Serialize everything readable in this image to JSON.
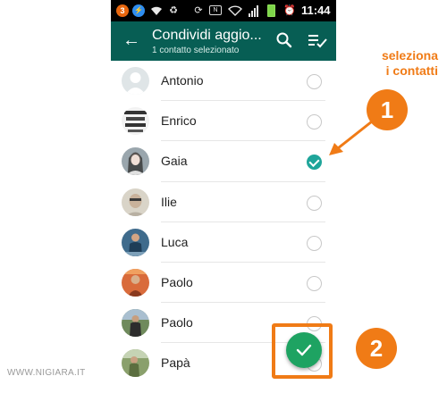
{
  "status_bar": {
    "notification_badge": "3",
    "time": "11:44",
    "icons": [
      "notification-badge-icon",
      "messenger-icon",
      "wifi-icon",
      "recycle-icon",
      "sync-icon",
      "nfc-icon",
      "wifi-signal-icon",
      "cell-signal-icon",
      "battery-icon",
      "alarm-icon"
    ]
  },
  "app_bar": {
    "back_icon": "arrow-left-icon",
    "title": "Condividi aggio...",
    "subtitle": "1 contatto selezionato",
    "actions": [
      "search-icon",
      "select-all-icon"
    ]
  },
  "contacts": [
    {
      "name": "Antonio",
      "avatar": "default-avatar",
      "selected": false
    },
    {
      "name": "Enrico",
      "avatar": "photo-avatar",
      "selected": false
    },
    {
      "name": "Gaia",
      "avatar": "photo-avatar",
      "selected": true
    },
    {
      "name": "Ilie",
      "avatar": "photo-avatar",
      "selected": false
    },
    {
      "name": "Luca",
      "avatar": "photo-avatar",
      "selected": false
    },
    {
      "name": "Paolo",
      "avatar": "photo-avatar",
      "selected": false
    },
    {
      "name": "Paolo",
      "avatar": "photo-avatar",
      "selected": false
    },
    {
      "name": "Papà",
      "avatar": "photo-avatar",
      "selected": false
    }
  ],
  "fab": {
    "icon": "check-icon"
  },
  "annotations": {
    "label_line1": "seleziona",
    "label_line2": "i contatti",
    "step1": "1",
    "step2": "2"
  },
  "watermark": "WWW.NIGIARA.IT",
  "colors": {
    "app_bar": "#075e54",
    "accent": "#1fa59a",
    "fab": "#1ea362",
    "annotation": "#f07b16"
  }
}
